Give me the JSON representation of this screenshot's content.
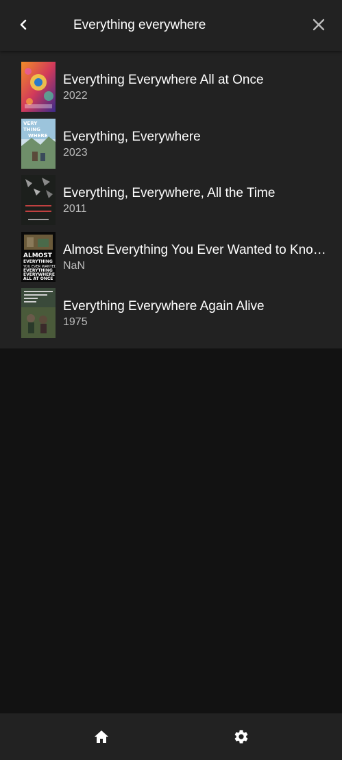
{
  "header": {
    "title": "Everything everywhere",
    "back_icon": "chevron-left-icon",
    "close_icon": "close-icon"
  },
  "results": [
    {
      "title": "Everything Everywhere All at Once",
      "year": "2022"
    },
    {
      "title": "Everything, Everywhere",
      "year": "2023"
    },
    {
      "title": "Everything, Everywhere, All the Time",
      "year": "2011"
    },
    {
      "title": "Almost Everything You Ever Wanted to Know About Everything Everywhere All at Once",
      "year": "NaN"
    },
    {
      "title": "Everything Everywhere Again Alive",
      "year": "1975"
    }
  ],
  "posters": {
    "p1_text": "",
    "p2_text": "VERY THING WHERE",
    "p3_text": "EVERYTHING EVERYWHERE ALL THE TIME",
    "p4_text": "ALMOST EVERYTHING YOU EVER WANTED TO KNOW ABOUT EVERYTHING EVERYWHERE ALL AT ONCE",
    "p5_text": "EVERYTHING EVERYWHERE AGAIN ALIVE"
  },
  "bottom_nav": {
    "home_icon": "home-icon",
    "settings_icon": "gear-icon"
  },
  "colors": {
    "background": "#121212",
    "surface": "#222222",
    "text_primary": "#ffffff",
    "text_secondary": "#bdbdbd"
  }
}
